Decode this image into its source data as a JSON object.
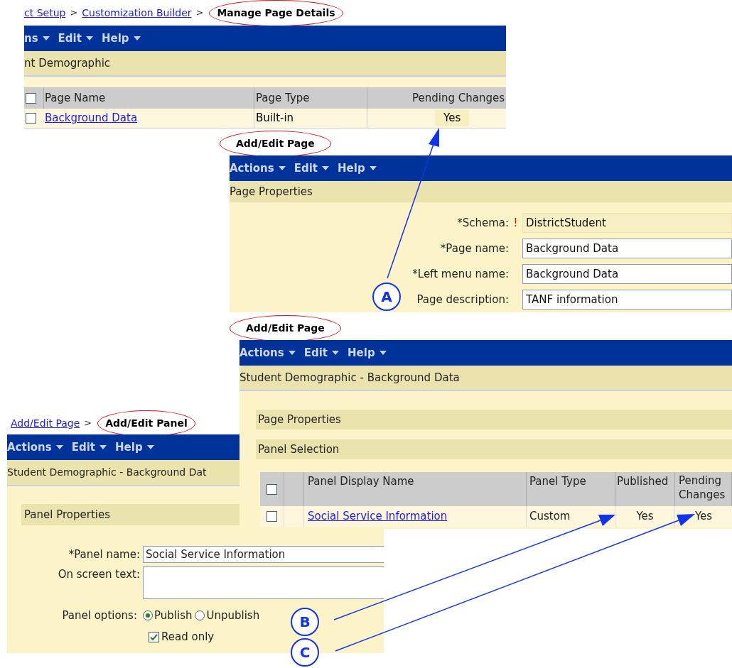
{
  "manage_page": {
    "breadcrumb": [
      {
        "text": "ct Setup",
        "kind": "link"
      },
      {
        "text": ">",
        "kind": "separator"
      },
      {
        "text": "Customization Builder",
        "kind": "link"
      },
      {
        "text": ">",
        "kind": "separator"
      },
      {
        "text": "Manage Page Details",
        "kind": "current"
      }
    ],
    "menu": [
      "ns",
      "Edit",
      "Help"
    ],
    "header": "nt Demographic",
    "table": {
      "header_checked": false,
      "columns": [
        "Page Name",
        "Page Type",
        "Pending Changes"
      ],
      "rows": [
        {
          "checked": false,
          "cells": [
            "Background Data",
            "Built-in",
            "Yes"
          ]
        }
      ]
    }
  },
  "page_properties": {
    "title": "Add/Edit Page",
    "menu": [
      "Actions",
      "Edit",
      "Help"
    ],
    "header": "Page Properties",
    "fields": [
      {
        "label": "*Schema:",
        "required_mark": "!",
        "value": "DistrictStudent",
        "readonly": true
      },
      {
        "label": "*Page name:",
        "value": "Background Data",
        "readonly": false
      },
      {
        "label": "*Left menu name:",
        "value": "Background Data",
        "readonly": false
      },
      {
        "label": "Page description:",
        "value": "TANF information",
        "readonly": false
      }
    ]
  },
  "panel_selection": {
    "title": "Add/Edit Page",
    "menu": [
      "Actions",
      "Edit",
      "Help"
    ],
    "header": "Student Demographic - Background Data",
    "sections": [
      "Page Properties",
      "Panel Selection"
    ],
    "table": {
      "header_checked": false,
      "columns": [
        "Panel Display Name",
        "Panel Type",
        "Published",
        "Pending Changes"
      ],
      "rows": [
        {
          "checked": false,
          "cells": [
            "Social Service Information",
            "Custom",
            "Yes",
            "Yes"
          ]
        }
      ]
    }
  },
  "panel_properties": {
    "breadcrumb": [
      {
        "text": "Add/Edit Page",
        "kind": "link"
      },
      {
        "text": ">",
        "kind": "separator"
      },
      {
        "text": "Add/Edit Panel",
        "kind": "current"
      }
    ],
    "menu": [
      "Actions",
      "Edit",
      "Help"
    ],
    "header": "Student Demographic - Background Dat",
    "section": "Panel Properties",
    "name_label": "*Panel name:",
    "name_value": "Social Service Information",
    "text_label": "On screen text:",
    "options_label": "Panel options:",
    "options": [
      {
        "label": "Publish",
        "selected": true
      },
      {
        "label": "Unpublish",
        "selected": false
      }
    ],
    "read_only": {
      "label": "Read only",
      "checked": true
    }
  },
  "callouts": [
    {
      "letter": "A"
    },
    {
      "letter": "B"
    },
    {
      "letter": "C"
    }
  ]
}
